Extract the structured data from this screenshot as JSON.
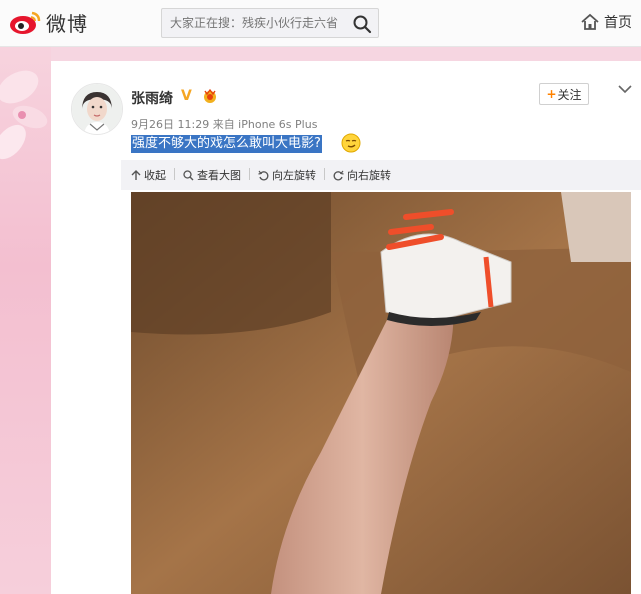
{
  "brand": {
    "logo_text": "微博"
  },
  "search": {
    "placeholder": "大家正在搜：残疾小伙行走六省"
  },
  "nav": {
    "home_label": "首页"
  },
  "post": {
    "author": "张雨绮",
    "verified_mark": "V",
    "meta": "9月26日 11:29 来自 iPhone 6s Plus",
    "text": "强度不够大的戏怎么敢叫大电影?",
    "follow_label": "关注",
    "actions": [
      {
        "label": "收起",
        "icon": "collapse-arrow-icon"
      },
      {
        "label": "查看大图",
        "icon": "magnifier-icon"
      },
      {
        "label": "向左旋转",
        "icon": "rotate-left-icon"
      },
      {
        "label": "向右旋转",
        "icon": "rotate-right-icon"
      }
    ]
  },
  "colors": {
    "accent": "#ff8200",
    "selection": "#3a75c4",
    "bg_pink": "#f5c9d6"
  }
}
